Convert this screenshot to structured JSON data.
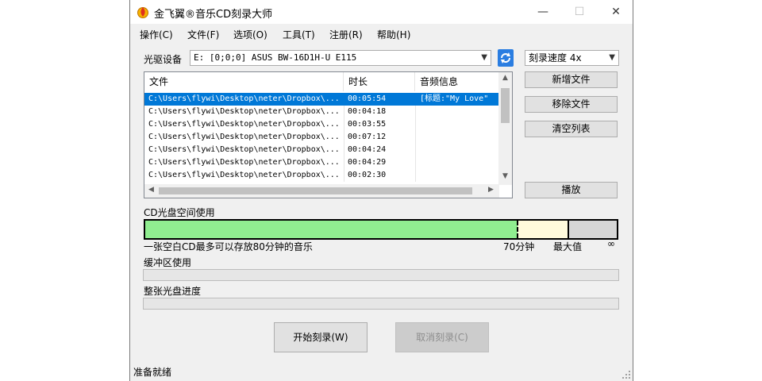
{
  "window": {
    "title": "金飞翼®音乐CD刻录大师",
    "minimize": "—",
    "maximize": "☐",
    "close": "✕"
  },
  "menu": [
    "操作(C)",
    "文件(F)",
    "选项(O)",
    "工具(T)",
    "注册(R)",
    "帮助(H)"
  ],
  "drive": {
    "label": "光驱设备",
    "value": "E:  [0;0;0] ASUS BW-16D1H-U E115"
  },
  "burn_speed": {
    "value": "刻录速度 4x"
  },
  "file_list": {
    "columns": [
      "文件",
      "时长",
      "音频信息"
    ],
    "rows": [
      {
        "file": "C:\\Users\\flywi\\Desktop\\neter\\Dropbox\\...",
        "duration": "00:05:54",
        "info": "[标题:\"My Love\"",
        "selected": true
      },
      {
        "file": "C:\\Users\\flywi\\Desktop\\neter\\Dropbox\\...",
        "duration": "00:04:18",
        "info": ""
      },
      {
        "file": "C:\\Users\\flywi\\Desktop\\neter\\Dropbox\\...",
        "duration": "00:03:55",
        "info": ""
      },
      {
        "file": "C:\\Users\\flywi\\Desktop\\neter\\Dropbox\\...",
        "duration": "00:07:12",
        "info": ""
      },
      {
        "file": "C:\\Users\\flywi\\Desktop\\neter\\Dropbox\\...",
        "duration": "00:04:24",
        "info": ""
      },
      {
        "file": "C:\\Users\\flywi\\Desktop\\neter\\Dropbox\\...",
        "duration": "00:04:29",
        "info": ""
      },
      {
        "file": "C:\\Users\\flywi\\Desktop\\neter\\Dropbox\\...",
        "duration": "00:02:30",
        "info": ""
      }
    ]
  },
  "buttons": {
    "add_file": "新增文件",
    "remove_file": "移除文件",
    "clear_list": "清空列表",
    "play": "播放",
    "start_burn": "开始刻录(W)",
    "cancel_burn": "取消刻录(C)"
  },
  "cd_space": {
    "label": "CD光盘空间使用",
    "note": "一张空白CD最多可以存放80分钟的音乐",
    "mark_70": "70分钟",
    "mark_max": "最大值",
    "mark_inf": "∞",
    "used_fraction": 0.79,
    "limit_fraction": 0.895
  },
  "buffer": {
    "label": "缓冲区使用",
    "fraction": 0
  },
  "disc_progress": {
    "label": "整张光盘进度",
    "fraction": 0
  },
  "status": {
    "text": "准备就绪"
  },
  "colors": {
    "used": "#90ee90",
    "remaining": "#fffadc",
    "beyond": "#d6d6d6",
    "selection": "#0078d7"
  }
}
